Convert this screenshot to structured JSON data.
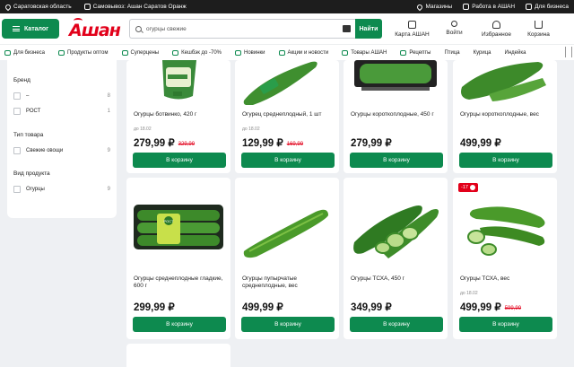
{
  "topbar": {
    "region": "Саратовская область",
    "pickup": "Самовывоз: Ашан Саратов Оранж",
    "links": [
      "Магазины",
      "Работа в АШАН",
      "Для бизнеса"
    ]
  },
  "header": {
    "catalog_label": "Каталог",
    "logo_text": "Ашан",
    "search_value": "огурцы свежие",
    "search_button": "Найти",
    "icons": [
      {
        "label": "Карта АШАН",
        "icon": "card-icon"
      },
      {
        "label": "Войти",
        "icon": "user-icon"
      },
      {
        "label": "Избранное",
        "icon": "heart-icon"
      },
      {
        "label": "Корзина",
        "icon": "cart-icon"
      }
    ]
  },
  "catnav": [
    "Для бизнеса",
    "Продукты оптом",
    "Суперцены",
    "Кешбэк до -70%",
    "Новинки",
    "Акции и новости",
    "Товары АШАН",
    "Рецепты",
    "Птица",
    "Курица",
    "Индейка"
  ],
  "filters": {
    "brand_title": "Бренд",
    "brand_items": [
      {
        "label": "–",
        "count": "8"
      },
      {
        "label": "РОСТ",
        "count": "1"
      }
    ],
    "type_title": "Тип товара",
    "type_items": [
      {
        "label": "Свежие овощи",
        "count": "9"
      }
    ],
    "kind_title": "Вид продукта",
    "kind_items": [
      {
        "label": "Огурцы",
        "count": "9"
      }
    ]
  },
  "cart_label": "В корзину",
  "products": [
    {
      "name": "Огурцы ботвинко, 420 г",
      "until": "до 18.02",
      "price": "279,99 ₽",
      "old_price": "329,99"
    },
    {
      "name": "Огурец среднеплодный, 1 шт",
      "until": "до 18.02",
      "price": "129,99 ₽",
      "old_price": "169,99"
    },
    {
      "name": "Огурцы короткоплодные, 450 г",
      "until": "",
      "price": "279,99 ₽",
      "old_price": ""
    },
    {
      "name": "Огурцы короткоплодные, вес",
      "until": "",
      "price": "499,99 ₽",
      "old_price": ""
    },
    {
      "name": "Огурцы среднеплодные гладкие, 600 г",
      "until": "",
      "price": "299,99 ₽",
      "old_price": ""
    },
    {
      "name": "Огурцы пупырчатые среднеплодные, вес",
      "until": "",
      "price": "499,99 ₽",
      "old_price": ""
    },
    {
      "name": "Огурцы ТСХА, 450 г",
      "until": "",
      "price": "349,99 ₽",
      "old_price": ""
    },
    {
      "name": "Огурцы ТСХА, вес",
      "until": "до 18.02",
      "price": "499,99 ₽",
      "old_price": "599,99",
      "badge": "-17"
    }
  ],
  "package_label": "РОСТ",
  "colors": {
    "brand_green": "#0d8a4f",
    "brand_red": "#e2001a",
    "cucumber": "#3d8a2a"
  }
}
